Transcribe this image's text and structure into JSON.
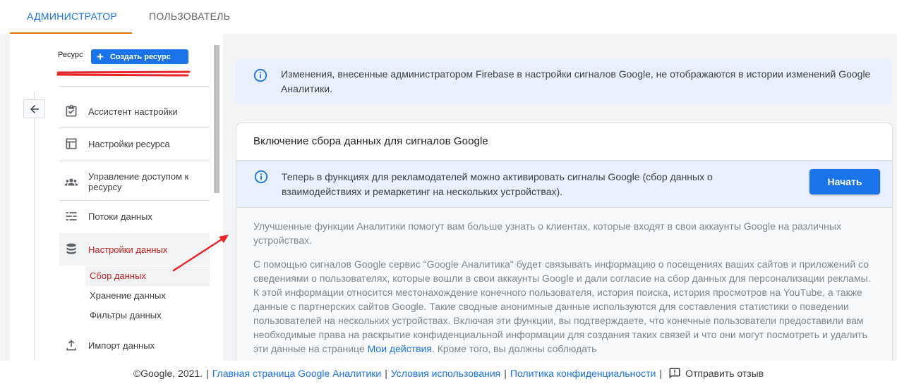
{
  "tabs": [
    {
      "label": "АДМИНИСТРАТОР",
      "active": true
    },
    {
      "label": "ПОЛЬЗОВАТЕЛЬ",
      "active": false
    }
  ],
  "sidebar": {
    "resource_label": "Ресурс",
    "create_button": "Создать ресурс",
    "items": [
      {
        "label": "Ассистент настройки",
        "icon": "checklist-icon"
      },
      {
        "label": "Настройки ресурса",
        "icon": "layout-icon"
      },
      {
        "label": "Управление доступом к ресурсу",
        "icon": "people-icon"
      },
      {
        "label": "Потоки данных",
        "icon": "streams-icon"
      },
      {
        "label": "Настройки данных",
        "icon": "database-icon",
        "active": true
      },
      {
        "label": "Импорт данных",
        "icon": "upload-icon"
      }
    ],
    "subitems": [
      {
        "label": "Сбор данных",
        "selected": true
      },
      {
        "label": "Хранение данных"
      },
      {
        "label": "Фильтры данных"
      }
    ]
  },
  "main": {
    "banner_text": "Изменения, внесенные администратором Firebase в настройки сигналов Google, не отображаются в истории изменений Google Аналитики.",
    "card": {
      "title": "Включение сбора данных для сигналов Google",
      "banner_text": "Теперь в функциях для рекламодателей можно активировать сигналы Google (сбор данных о взаимодействиях и ремаркетинг на нескольких устройствах).",
      "start_button": "Начать",
      "paragraph1": "Улучшенные функции Аналитики помогут вам больше узнать о клиентах, которые входят в свои аккаунты Google на различных устройствах.",
      "paragraph2_before": "С помощью сигналов Google сервис \"Google Аналитика\" будет связывать информацию о посещениях ваших сайтов и приложений со сведениями о пользователях, которые вошли в свои аккаунты Google и дали согласие на сбор данных для персонализации рекламы. К этой информации относится местонахождение конечного пользователя, история поиска, история просмотров на YouTube, а также данные с партнерских сайтов Google. Такие сводные анонимные данные используются для составления статистики о поведении пользователей на нескольких устройствах. Включая эти функции, вы подтверждаете, что конечные пользователи предоставили вам необходимые права на раскрытие конфиденциальной информации для создания таких связей и что они могут посмотреть и удалить эти данные на странице ",
      "paragraph2_link": "Мои действия",
      "paragraph2_after": ". Кроме того, вы должны соблюдать"
    }
  },
  "footer": {
    "copyright": "©Google, 2021.",
    "links": [
      "Главная страница Google Аналитики",
      "Условия использования",
      "Политика конфиденциальности"
    ],
    "feedback": "Отправить отзыв"
  },
  "colors": {
    "accent": "#1a73e8",
    "tab_underline": "#e37400",
    "active_nav": "#c5221f",
    "banner_bg": "#e8f0fe",
    "annotation_arrow": "#e8262a"
  }
}
